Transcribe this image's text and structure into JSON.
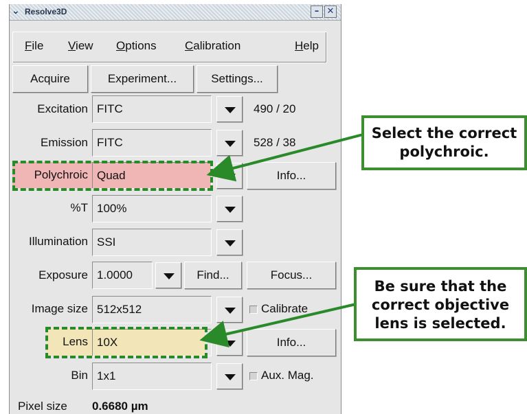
{
  "window": {
    "title": "Resolve3D"
  },
  "menu": [
    {
      "label": "File",
      "mnemonic": "F",
      "rest": "ile"
    },
    {
      "label": "View",
      "mnemonic": "V",
      "rest": "iew"
    },
    {
      "label": "Options",
      "mnemonic": "O",
      "rest": "ptions"
    },
    {
      "label": "Calibration",
      "mnemonic": "C",
      "rest": "alibration"
    },
    {
      "label": "Help",
      "mnemonic": "H",
      "rest": "elp"
    }
  ],
  "toolbar": {
    "acquire": "Acquire",
    "experiment": "Experiment...",
    "settings": "Settings..."
  },
  "rows": {
    "excitation": {
      "label": "Excitation",
      "value": "FITC",
      "readout": "490 / 20"
    },
    "emission": {
      "label": "Emission",
      "value": "FITC",
      "readout": "528 / 38"
    },
    "polychroic": {
      "label": "Polychroic",
      "value": "Quad",
      "button": "Info..."
    },
    "transmission": {
      "label": "%T",
      "value": "100%"
    },
    "illumination": {
      "label": "Illumination",
      "value": "SSI"
    },
    "exposure": {
      "label": "Exposure",
      "value": "1.0000",
      "find": "Find...",
      "focus": "Focus..."
    },
    "image_size": {
      "label": "Image size",
      "value": "512x512",
      "checkbox": "Calibrate"
    },
    "lens": {
      "label": "Lens",
      "value": "10X",
      "button": "Info..."
    },
    "bin": {
      "label": "Bin",
      "value": "1x1",
      "checkbox": "Aux. Mag."
    },
    "pixel_size": {
      "label": "Pixel size",
      "value": "0.6680 µm"
    }
  },
  "callouts": {
    "polychroic": "Select the correct polychroic.",
    "lens": "Be sure that the correct objective lens is selected."
  },
  "colors": {
    "highlight_red": "#f0b6b6",
    "highlight_yellow": "#f2e6b8",
    "callout_green": "#3b8f2f"
  }
}
